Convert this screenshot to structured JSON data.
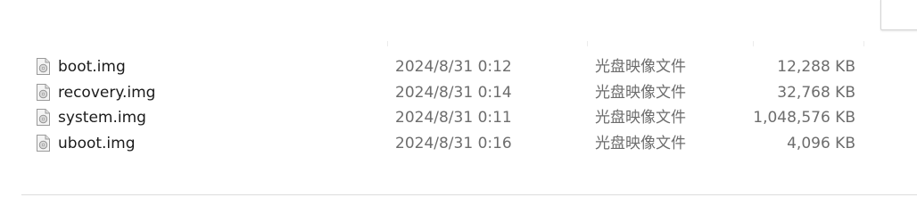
{
  "files": [
    {
      "name": "boot.img",
      "date_modified": "2024/8/31 0:12",
      "type": "光盘映像文件",
      "size": "12,288 KB",
      "icon": "disc-image-file-icon"
    },
    {
      "name": "recovery.img",
      "date_modified": "2024/8/31 0:14",
      "type": "光盘映像文件",
      "size": "32,768 KB",
      "icon": "disc-image-file-icon"
    },
    {
      "name": "system.img",
      "date_modified": "2024/8/31 0:11",
      "type": "光盘映像文件",
      "size": "1,048,576 KB",
      "icon": "disc-image-file-icon"
    },
    {
      "name": "uboot.img",
      "date_modified": "2024/8/31 0:16",
      "type": "光盘映像文件",
      "size": "4,096 KB",
      "icon": "disc-image-file-icon"
    }
  ],
  "colors": {
    "name_text": "#1b1b1b",
    "detail_text": "#6d6d6d",
    "divider": "#dcdcdc"
  }
}
